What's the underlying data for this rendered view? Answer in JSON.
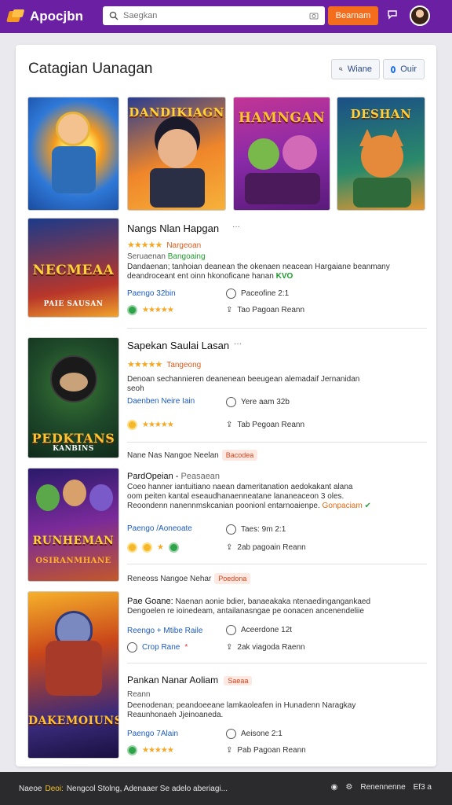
{
  "app": {
    "name": "Apocjbn"
  },
  "search": {
    "placeholder": "Saegkan",
    "button_label": "Bearnam"
  },
  "page": {
    "title": "Catagian Uanagan"
  },
  "header_buttons": {
    "filter_label": "Wiane",
    "other_label": "Ouir"
  },
  "top_thumbs": [
    {
      "art": ""
    },
    {
      "art": "DANDIKIAGN"
    },
    {
      "art": "HAMNGAN"
    },
    {
      "art": "DESHAN"
    }
  ],
  "items": [
    {
      "title": "Nangs Nlan Hapgan",
      "rating_tag": "Nargeoan",
      "sub": "Seruaenan",
      "sub_tag": "Bangoaing",
      "desc1": "Dandaenan; tanhoian deanean the okenaen neacean Hargaiane beanmany",
      "desc2": "deandroceant ent oinn hkonoficane hanan",
      "desc2_tag": "KVO",
      "link": "Paengo 32bin",
      "meta1": "Paceofine 2:1",
      "meta2": "Tao Pagoan Reann",
      "art": "NECMEAA",
      "art2": "PAIE SAUSAN"
    },
    {
      "title": "Sapekan Saulai Lasan",
      "rating_tag": "Tangeong",
      "desc1": "Denoan sechannieren deanenean beeugean alemadaif Jernanidan",
      "desc2": "seoh",
      "link": "Daenben Neire Iain",
      "meta1": "Yere aam 32b",
      "meta2": "Tab Pegoan Reann",
      "art": "PEDKTANS",
      "art2": "KANBINS"
    },
    {
      "header": "Nane Nas Nangoe Neelan",
      "header_tag": "Bacodea",
      "title": "PardOpeian",
      "title_suffix": "Peasaean",
      "desc1": "Coeo hanner iantuitiano naean dameritanation aedokakant alana",
      "desc2": "oom peiten kantal eseaudhanaenneatane lananeaceon 3 oles.",
      "desc3": "Reoondenn nanennmskcanian poonionl entarnoaienpe.",
      "desc3_tag": "Gonpaciam",
      "link": "Paengo /Aoneoate",
      "meta1": "Taes: 9m 2:1",
      "meta2": "2ab pagoain Reann",
      "art": "RUNHEMAN",
      "art2": "OSIRANMHANE"
    },
    {
      "header": "Reneoss Nangoe Nehar",
      "header_tag": "Poedona",
      "title": "Pae Goane:",
      "desc1": "Naenan aonie bdier, banaeakaka ntenaedingangankaed",
      "desc2": "Dengoelen re ioinedeam, antailanasngae pe oonacen ancenendeliie",
      "link": "Reengo + Mtibe Raile",
      "meta1": "Aceerdone 12t",
      "meta2": "2ak viagoda Raenn",
      "chip": "Crop Rane",
      "art": "DAKEMOIUNS",
      "art2": ""
    },
    {
      "title": "Pankan Nanar Aoliam",
      "title_tag": "Saeaa",
      "sub": "Reann",
      "desc1": "Deenodenan; peandoeeane lamkaoleafen in Hunadenn Naragkay",
      "desc2": "Reaunhonaeh Jjeinoaneda.",
      "link": "Paengo 7Alain",
      "meta1": "Aeisone 2:1",
      "meta2": "Pab Pagoan Reann"
    }
  ],
  "footer": {
    "left_text": "Naeoe",
    "highlight": "Deoi:",
    "rest": "Nengcol Stolng, Adenaaer Se adelo aberiagi...",
    "right_text": "Renennenne",
    "right_count": "Ef3 a"
  },
  "colors": {
    "topbar": "#6b1fa3",
    "accent": "#f36d1c",
    "star": "#f5a623",
    "link": "#1d5bbf"
  }
}
